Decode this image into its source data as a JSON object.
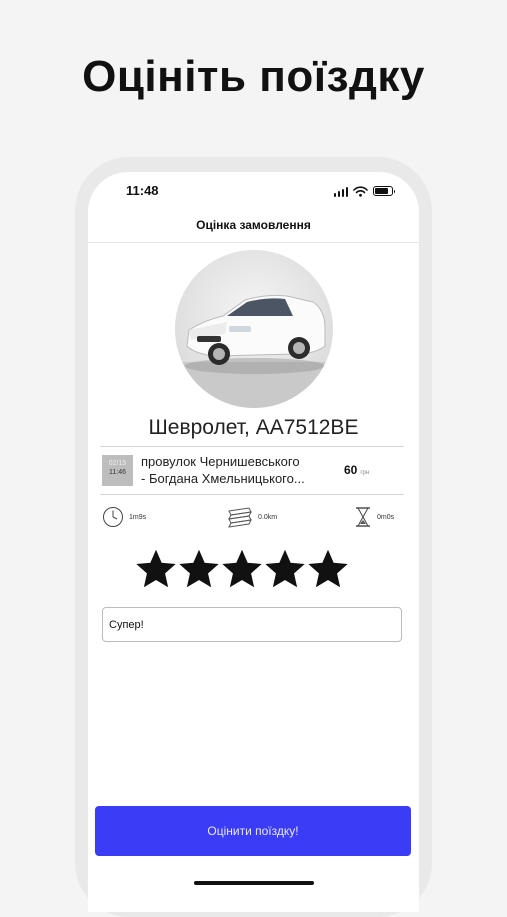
{
  "promo": {
    "title": "Оцініть поїздку"
  },
  "status_bar": {
    "time": "11:48",
    "icons": [
      "signal-icon",
      "wifi-icon",
      "battery-icon"
    ]
  },
  "screen": {
    "title": "Оцінка замовлення"
  },
  "car": {
    "name": "Шевролет, АА7512ВЕ",
    "photo": "car-photo"
  },
  "trip": {
    "date": "02/15",
    "time": "11:46",
    "route_line1": "провулок Чернишевського",
    "route_line2": "- Богдана Хмельницького...",
    "price": "60",
    "currency": "грн"
  },
  "stats": [
    {
      "icon": "clock-icon",
      "value": "1m9s"
    },
    {
      "icon": "road-icon",
      "value": "0.0km"
    },
    {
      "icon": "hourglass-icon",
      "value": "0m0s"
    }
  ],
  "rating": {
    "value": 5,
    "max": 5
  },
  "comment": {
    "value": "Супер!"
  },
  "submit_label": "Оцінити поїздку!",
  "colors": {
    "accent": "#3b3cf6",
    "background": "#f4f4f4",
    "star": "#111111"
  }
}
